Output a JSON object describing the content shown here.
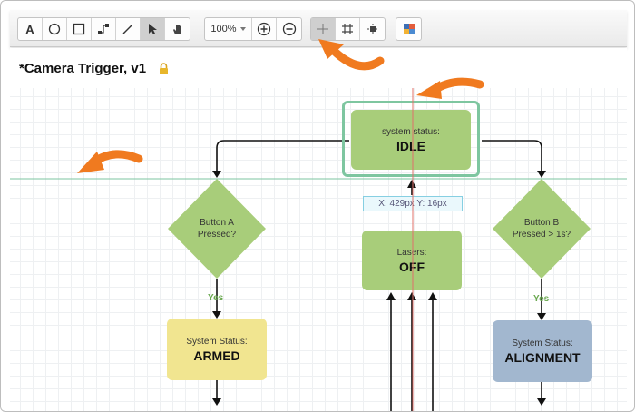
{
  "window": {
    "document_title": "*Camera Trigger, v1",
    "lock_icon": "lock-icon"
  },
  "toolbar": {
    "tools": [
      {
        "name": "text-tool",
        "icon": "text-icon",
        "glyph": "A"
      },
      {
        "name": "ellipse-tool",
        "icon": "circle-icon"
      },
      {
        "name": "rectangle-tool",
        "icon": "square-icon"
      },
      {
        "name": "connector-tool",
        "icon": "connector-icon"
      },
      {
        "name": "line-tool",
        "icon": "line-icon"
      },
      {
        "name": "select-tool",
        "icon": "pointer-icon",
        "active": true
      },
      {
        "name": "pan-tool",
        "icon": "hand-icon"
      }
    ],
    "zoom_value": "100%",
    "zoom_in_icon": "plus-circle-icon",
    "zoom_out_icon": "minus-circle-icon",
    "view_tools": [
      {
        "name": "guides-toggle",
        "icon": "crosshair-icon",
        "active": true
      },
      {
        "name": "grid-toggle",
        "icon": "grid-icon"
      },
      {
        "name": "snap-toggle",
        "icon": "snap-icon"
      }
    ],
    "palette_icon": "color-palette-icon"
  },
  "diagram": {
    "nodes": {
      "idle": {
        "sub": "system status:",
        "main": "IDLE"
      },
      "lasers": {
        "sub": "Lasers:",
        "main": "OFF"
      },
      "armed": {
        "sub": "System Status:",
        "main": "ARMED"
      },
      "alignment": {
        "sub": "System Status:",
        "main": "ALIGNMENT"
      }
    },
    "decisions": {
      "button_a": {
        "line1": "Button A",
        "line2": "Pressed?"
      },
      "button_b": {
        "line1": "Button B",
        "line2": "Pressed > 1s?"
      }
    },
    "edge_labels": {
      "yes_a": "Yes",
      "yes_b": "Yes"
    },
    "coordinate_readout": "X: 429px Y: 16px",
    "colors": {
      "process_green": "#a8cd7a",
      "armed_yellow": "#f1e590",
      "alignment_blue": "#a2b7cf",
      "selection_border": "#7ec6a0",
      "annotation_arrow": "#f07a1f",
      "guide_horizontal": "#7ec6a0",
      "guide_vertical": "#e0706a"
    }
  }
}
